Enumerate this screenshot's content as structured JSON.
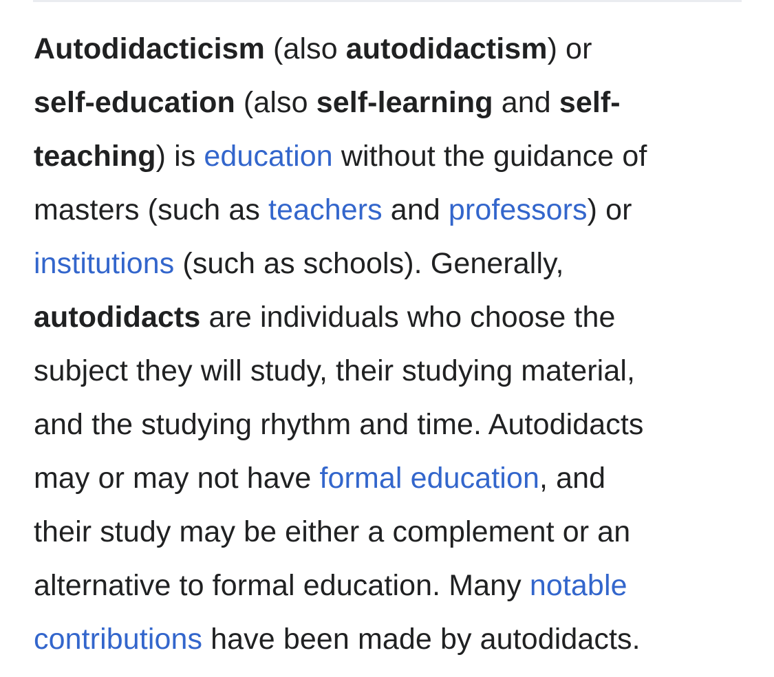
{
  "article": {
    "line1": {
      "b1": "Autodidacticism",
      "t1": " (also ",
      "b2": "autodidactism",
      "t2": ") or"
    },
    "line2": {
      "b1": "self-education",
      "t1": " (also ",
      "b2": "self-learning",
      "t2": " and ",
      "b3": "self-"
    },
    "line3": {
      "b1": "teaching",
      "t1": ") is ",
      "link1": "education",
      "t2": " without the guidance of"
    },
    "line4": {
      "t1": "masters (such as ",
      "link1": "teachers",
      "t2": " and ",
      "link2": "professors",
      "t3": ") or"
    },
    "line5": {
      "link1": "institutions",
      "t1": " (such as schools). Generally,"
    },
    "line6": {
      "b1": "autodidacts",
      "t1": " are individuals who choose the"
    },
    "line7": {
      "t1": "subject they will study, their studying material,"
    },
    "line8": {
      "t1": "and the studying rhythm and time. Autodidacts"
    },
    "line9": {
      "t1": "may or may not have ",
      "link1": "formal education",
      "t2": ", and"
    },
    "line10": {
      "t1": "their study may be either a complement or an"
    },
    "line11": {
      "t1": "alternative to formal education. Many ",
      "link1": "notable"
    },
    "line12": {
      "link1": "contributions",
      "t1": " have been made by autodidacts."
    }
  },
  "colors": {
    "text": "#202122",
    "link": "#3366cc",
    "divider": "#eaecf0",
    "background": "#ffffff"
  }
}
